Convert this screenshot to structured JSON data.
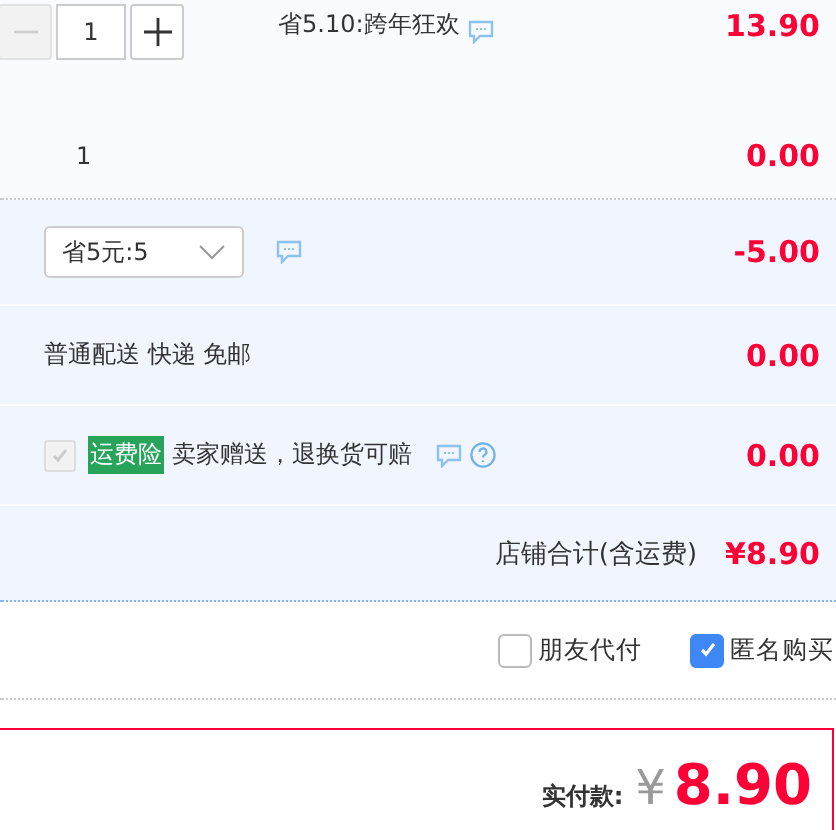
{
  "item": {
    "quantity": {
      "value": "1",
      "minus_disabled": true
    },
    "promo": "省5.10:跨年狂欢",
    "price": "13.90"
  },
  "gift_row": {
    "quantity": "1",
    "price": "0.00"
  },
  "coupon": {
    "select_value": "省5元:5",
    "amount": "-5.00"
  },
  "shipping": {
    "label": "普通配送 快递 免邮",
    "price": "0.00"
  },
  "insurance": {
    "checked": true,
    "disabled": true,
    "badge": "运费险",
    "text": "卖家赠送，退换货可赔",
    "price": "0.00"
  },
  "store_total": {
    "label": "店铺合计(含运费)",
    "amount": "¥8.90"
  },
  "options": [
    {
      "label": "朋友代付",
      "checked": false
    },
    {
      "label": "匿名购买",
      "checked": true
    }
  ],
  "payment": {
    "label": "实付款:",
    "currency": "¥",
    "amount": "8.90"
  }
}
